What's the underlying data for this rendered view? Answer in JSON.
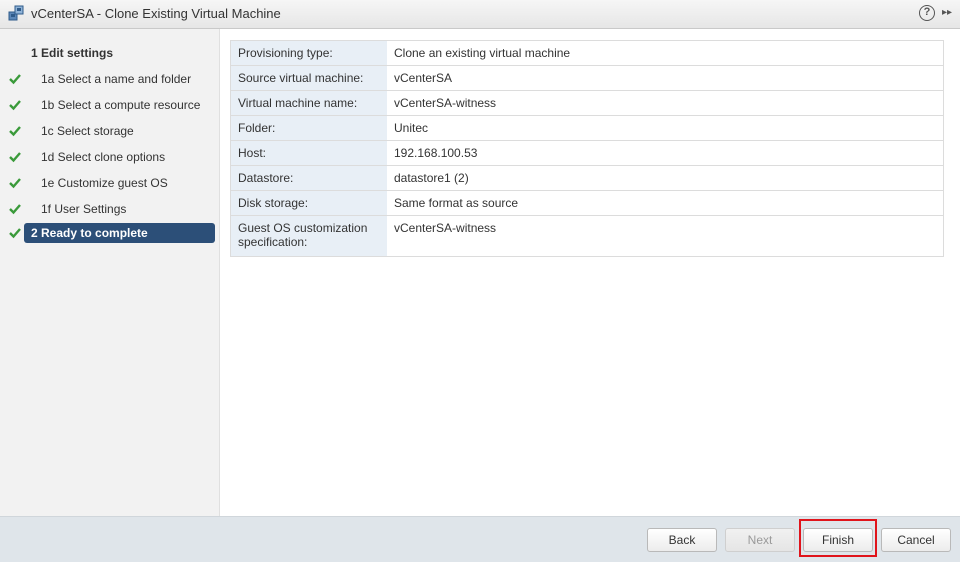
{
  "window": {
    "title": "vCenterSA - Clone Existing Virtual Machine",
    "icon": "clone-vm-icon",
    "help_glyph": "?",
    "expand_glyph": "▸▸"
  },
  "steps": [
    {
      "label": "1  Edit settings",
      "done": false
    },
    {
      "label": "1a  Select a name and folder",
      "done": true
    },
    {
      "label": "1b  Select a compute resource",
      "done": true
    },
    {
      "label": "1c  Select storage",
      "done": true
    },
    {
      "label": "1d  Select clone options",
      "done": true
    },
    {
      "label": "1e  Customize guest OS",
      "done": true
    },
    {
      "label": "1f  User Settings",
      "done": true
    },
    {
      "label": "2  Ready to complete",
      "done": true,
      "selected": true
    }
  ],
  "review": [
    {
      "key": "Provisioning type:",
      "value": "Clone an existing virtual machine"
    },
    {
      "key": "Source virtual machine:",
      "value": "vCenterSA"
    },
    {
      "key": "Virtual machine name:",
      "value": "vCenterSA-witness"
    },
    {
      "key": "Folder:",
      "value": "Unitec"
    },
    {
      "key": "Host:",
      "value": "192.168.100.53"
    },
    {
      "key": "Datastore:",
      "value": "datastore1 (2)"
    },
    {
      "key": "Disk storage:",
      "value": "Same format as source"
    },
    {
      "key": "Guest OS customization specification:",
      "value": "vCenterSA-witness"
    }
  ],
  "buttons": {
    "back": "Back",
    "next": "Next",
    "finish": "Finish",
    "cancel": "Cancel"
  },
  "colors": {
    "selected_step": "#2c4f78",
    "check": "#3a9a3a",
    "highlight": "#e0141b",
    "key_cell": "#e8eff6"
  }
}
